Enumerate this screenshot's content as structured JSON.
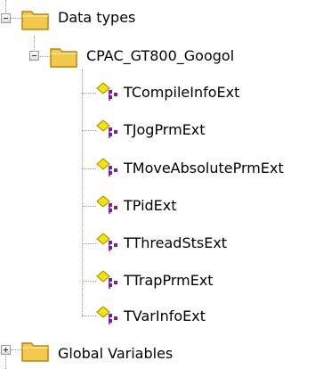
{
  "tree": {
    "data_types": {
      "label": "Data types",
      "icon": "folder-icon",
      "state": "expanded"
    },
    "library": {
      "label": "CPAC_GT800_Googol",
      "icon": "folder-icon",
      "state": "expanded",
      "items": [
        {
          "label": "TCompileInfoExt",
          "icon": "struct-type-icon"
        },
        {
          "label": "TJogPrmExt",
          "icon": "struct-type-icon"
        },
        {
          "label": "TMoveAbsolutePrmExt",
          "icon": "struct-type-icon"
        },
        {
          "label": "TPidExt",
          "icon": "struct-type-icon"
        },
        {
          "label": "TThreadStsExt",
          "icon": "struct-type-icon"
        },
        {
          "label": "TTrapPrmExt",
          "icon": "struct-type-icon"
        },
        {
          "label": "TVarInfoExt",
          "icon": "struct-type-icon"
        }
      ]
    },
    "global_variables": {
      "label": "Global Variables",
      "icon": "folder-icon",
      "state": "collapsed"
    },
    "colors": {
      "folder": "#f2c94c",
      "folder_border": "#b8860b",
      "struct_yellow": "#f5e400",
      "struct_purple": "#7a1fa2"
    }
  }
}
